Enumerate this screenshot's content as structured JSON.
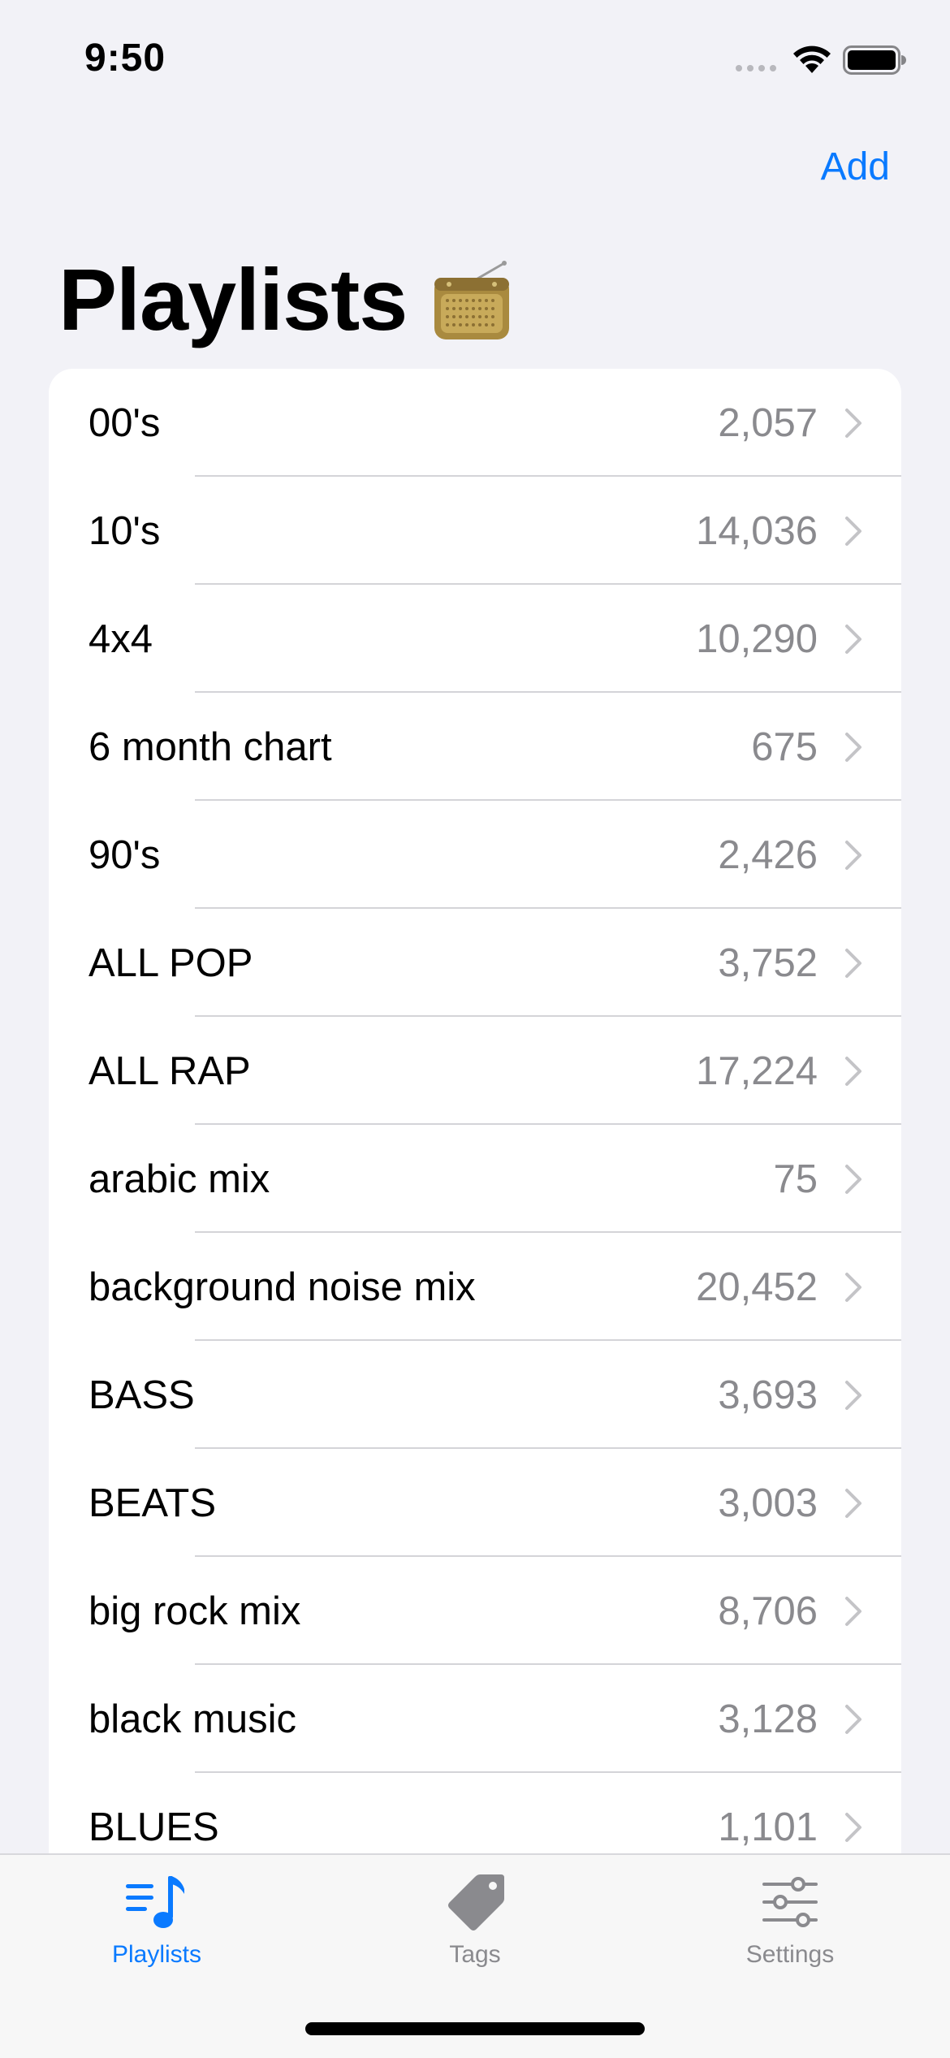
{
  "status_bar": {
    "time": "9:50"
  },
  "nav": {
    "add_label": "Add",
    "title": "Playlists",
    "title_icon": "radio-icon"
  },
  "playlists": [
    {
      "name": "00's",
      "count": "2,057"
    },
    {
      "name": "10's",
      "count": "14,036"
    },
    {
      "name": "4x4",
      "count": "10,290"
    },
    {
      "name": "6 month chart",
      "count": "675"
    },
    {
      "name": "90's",
      "count": "2,426"
    },
    {
      "name": "ALL POP",
      "count": "3,752"
    },
    {
      "name": "ALL RAP",
      "count": "17,224"
    },
    {
      "name": "arabic mix",
      "count": "75"
    },
    {
      "name": "background noise mix",
      "count": "20,452"
    },
    {
      "name": "BASS",
      "count": "3,693"
    },
    {
      "name": "BEATS",
      "count": "3,003"
    },
    {
      "name": "big rock mix",
      "count": "8,706"
    },
    {
      "name": "black music",
      "count": "3,128"
    },
    {
      "name": "BLUES",
      "count": "1,101"
    }
  ],
  "tab_bar": {
    "tabs": [
      {
        "label": "Playlists",
        "icon": "music-list-icon",
        "active": true
      },
      {
        "label": "Tags",
        "icon": "tag-icon",
        "active": false
      },
      {
        "label": "Settings",
        "icon": "sliders-icon",
        "active": false
      }
    ]
  },
  "colors": {
    "accent": "#0a7aff",
    "secondary_text": "#8a8a8e",
    "background": "#f2f2f7"
  }
}
